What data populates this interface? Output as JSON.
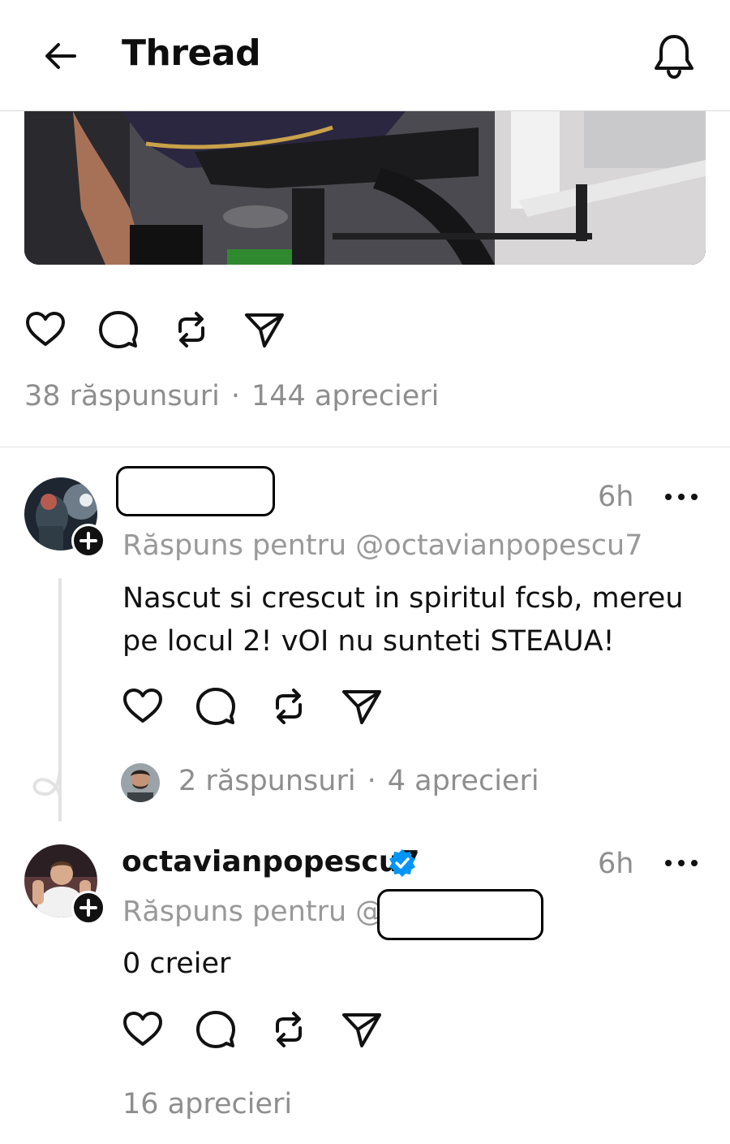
{
  "header": {
    "title": "Thread",
    "back_icon": "arrow-left-icon",
    "notifications_icon": "bell-icon"
  },
  "post": {
    "image_alt": "gym photo",
    "stats": {
      "replies": "38 răspunsuri",
      "separator": "·",
      "likes": "144 aprecieri"
    }
  },
  "replies": [
    {
      "time": "6h",
      "reply_to_label": "Răspuns pentru @octavianpopescu7",
      "text": "Nascut si crescut in spiritul fcsb, mereu pe locul 2! vOI nu sunteti STEAUA!",
      "stats": {
        "replies": "2 răspunsuri",
        "separator": "·",
        "likes": "4 aprecieri"
      }
    },
    {
      "username": "octavianpopescu7",
      "verified": true,
      "time": "6h",
      "reply_to_label": "Răspuns pentru @",
      "text": "0 creier",
      "stats": {
        "likes": "16 aprecieri"
      }
    }
  ],
  "colors": {
    "verified": "#0095f6",
    "muted": "#8e8e8e",
    "text": "#111111"
  }
}
